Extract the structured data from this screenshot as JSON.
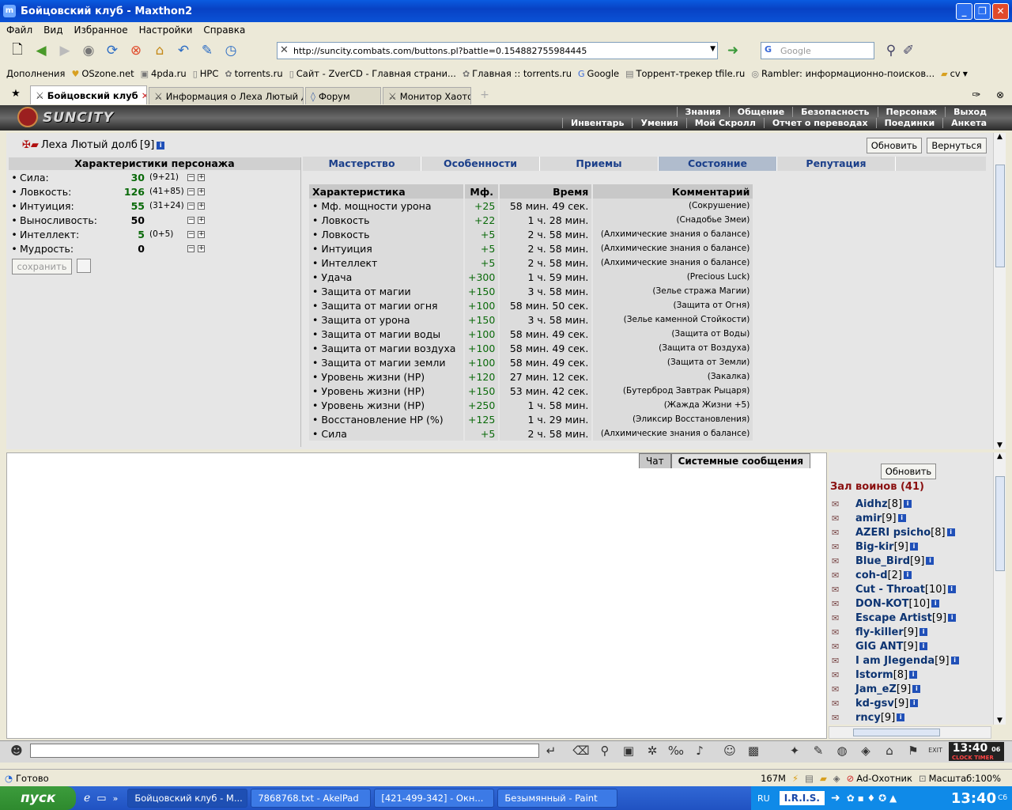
{
  "window": {
    "title": "Бойцовский клуб - Maxthon2"
  },
  "menu": [
    "Файл",
    "Вид",
    "Избранное",
    "Настройки",
    "Справка"
  ],
  "address": {
    "url": "http://suncity.combats.com/buttons.pl?battle=0.154882755984445"
  },
  "search": {
    "placeholder": "Google"
  },
  "favorites": [
    {
      "label": "Дополнения"
    },
    {
      "label": "OSzone.net"
    },
    {
      "label": "4pda.ru"
    },
    {
      "label": "HPC"
    },
    {
      "label": "torrents.ru"
    },
    {
      "label": "Сайт - ZverCD - Главная страни..."
    },
    {
      "label": "Главная :: torrents.ru"
    },
    {
      "label": "Google"
    },
    {
      "label": "Торрент-трекер tfile.ru"
    },
    {
      "label": "Rambler: информационно-поисков..."
    },
    {
      "label": "cv"
    }
  ],
  "tabs": [
    {
      "label": "Бойцовский клуб"
    },
    {
      "label": "Информация о Леха Лютый долб"
    },
    {
      "label": "Форум"
    },
    {
      "label": "Монитор Хаотов"
    }
  ],
  "game": {
    "logo": "SUNCITY",
    "topnav": [
      "Знания",
      "Общение",
      "Безопасность",
      "Персонаж",
      "Выход"
    ],
    "subnav": [
      "Инвентарь",
      "Умения",
      "Мой Скролл",
      "Отчет о переводах",
      "Поединки",
      "Анкета"
    ]
  },
  "character": {
    "name": "Леха Лютый долб",
    "level": "[9]",
    "refresh_label": "Обновить",
    "back_label": "Вернуться",
    "stats_title": "Характеристики персонажа",
    "save_label": "сохранить",
    "stats": [
      {
        "name": "Сила:",
        "value": "30",
        "extra": "(9+21)"
      },
      {
        "name": "Ловкость:",
        "value": "126",
        "extra": "(41+85)"
      },
      {
        "name": "Интуиция:",
        "value": "55",
        "extra": "(31+24)"
      },
      {
        "name": "Выносливость:",
        "value": "50",
        "extra": ""
      },
      {
        "name": "Интеллект:",
        "value": "5",
        "extra": "(0+5)"
      },
      {
        "name": "Мудрость:",
        "value": "0",
        "extra": ""
      }
    ]
  },
  "content_tabs": [
    "Мастерство",
    "Особенности",
    "Приемы",
    "Состояние",
    "Репутация"
  ],
  "effects": {
    "headers": [
      "Характеристика",
      "Мф.",
      "Время",
      "Комментарий"
    ],
    "rows": [
      [
        "Мф. мощности урона",
        "+25",
        "58 мин. 49 сек.",
        "(Сокрушение)"
      ],
      [
        "Ловкость",
        "+22",
        "1 ч. 28 мин.",
        "(Снадобье Змеи)"
      ],
      [
        "Ловкость",
        "+5",
        "2 ч. 58 мин.",
        "(Алхимические знания о балансе)"
      ],
      [
        "Интуиция",
        "+5",
        "2 ч. 58 мин.",
        "(Алхимические знания о балансе)"
      ],
      [
        "Интеллект",
        "+5",
        "2 ч. 58 мин.",
        "(Алхимические знания о балансе)"
      ],
      [
        "Удача",
        "+300",
        "1 ч. 59 мин.",
        "(Precious Luck)"
      ],
      [
        "Защита от магии",
        "+150",
        "3 ч. 58 мин.",
        "(Зелье стража Магии)"
      ],
      [
        "Защита от магии огня",
        "+100",
        "58 мин. 50 сек.",
        "(Защита от Огня)"
      ],
      [
        "Защита от урона",
        "+150",
        "3 ч. 58 мин.",
        "(Зелье каменной Стойкости)"
      ],
      [
        "Защита от магии воды",
        "+100",
        "58 мин. 49 сек.",
        "(Защита от Воды)"
      ],
      [
        "Защита от магии воздуха",
        "+100",
        "58 мин. 49 сек.",
        "(Защита от Воздуха)"
      ],
      [
        "Защита от магии земли",
        "+100",
        "58 мин. 49 сек.",
        "(Защита от Земли)"
      ],
      [
        "Уровень жизни (HP)",
        "+120",
        "27 мин. 12 сек.",
        "(Закалка)"
      ],
      [
        "Уровень жизни (HP)",
        "+150",
        "53 мин. 42 сек.",
        "(Бутерброд Завтрак Рыцаря)"
      ],
      [
        "Уровень жизни (HP)",
        "+250",
        "1 ч. 58 мин.",
        "(Жажда Жизни +5)"
      ],
      [
        "Восстановление HP (%)",
        "+125",
        "1 ч. 29 мин.",
        "(Эликсир Восстановления)"
      ],
      [
        "Сила",
        "+5",
        "2 ч. 58 мин.",
        "(Алхимические знания о балансе)"
      ]
    ]
  },
  "chat": {
    "tab_chat": "Чат",
    "tab_system": "Системные сообщения"
  },
  "userlist": {
    "refresh_label": "Обновить",
    "title": "Зал воинов (41)",
    "users": [
      {
        "name": "Aidhz",
        "level": "[8]"
      },
      {
        "name": "amir",
        "level": "[9]"
      },
      {
        "name": "AZERI psicho",
        "level": "[8]"
      },
      {
        "name": "Big-kir",
        "level": "[9]"
      },
      {
        "name": "Blue_Bird",
        "level": "[9]"
      },
      {
        "name": "coh-d",
        "level": "[2]"
      },
      {
        "name": "Cut - Throat",
        "level": "[10]"
      },
      {
        "name": "DON-KOT",
        "level": "[10]"
      },
      {
        "name": "Escape Artist",
        "level": "[9]"
      },
      {
        "name": "fly-killer",
        "level": "[9]"
      },
      {
        "name": "GIG ANT",
        "level": "[9]"
      },
      {
        "name": "I am JIegenda",
        "level": "[9]"
      },
      {
        "name": "Istorm",
        "level": "[8]"
      },
      {
        "name": "Jam_eZ",
        "level": "[9]"
      },
      {
        "name": "kd-gsv",
        "level": "[9]"
      },
      {
        "name": "rncy",
        "level": "[9]"
      }
    ]
  },
  "clock": {
    "time": "13:40",
    "sec": "06",
    "label": "CLOCK TIMER"
  },
  "status": {
    "left": "Готово",
    "mem": "167M",
    "adblock": "Ad-Охотник",
    "zoom": "Масштаб:100%"
  },
  "taskbar": {
    "start": "пуск",
    "tasks": [
      "Бойцовский клуб - M...",
      "7868768.txt - AkelPad",
      "[421-499-342] - Окн...",
      "Безымянный - Paint"
    ],
    "lang": "RU",
    "tray_app": "I.R.I.S.",
    "time": "13:40",
    "day": "Сб"
  }
}
